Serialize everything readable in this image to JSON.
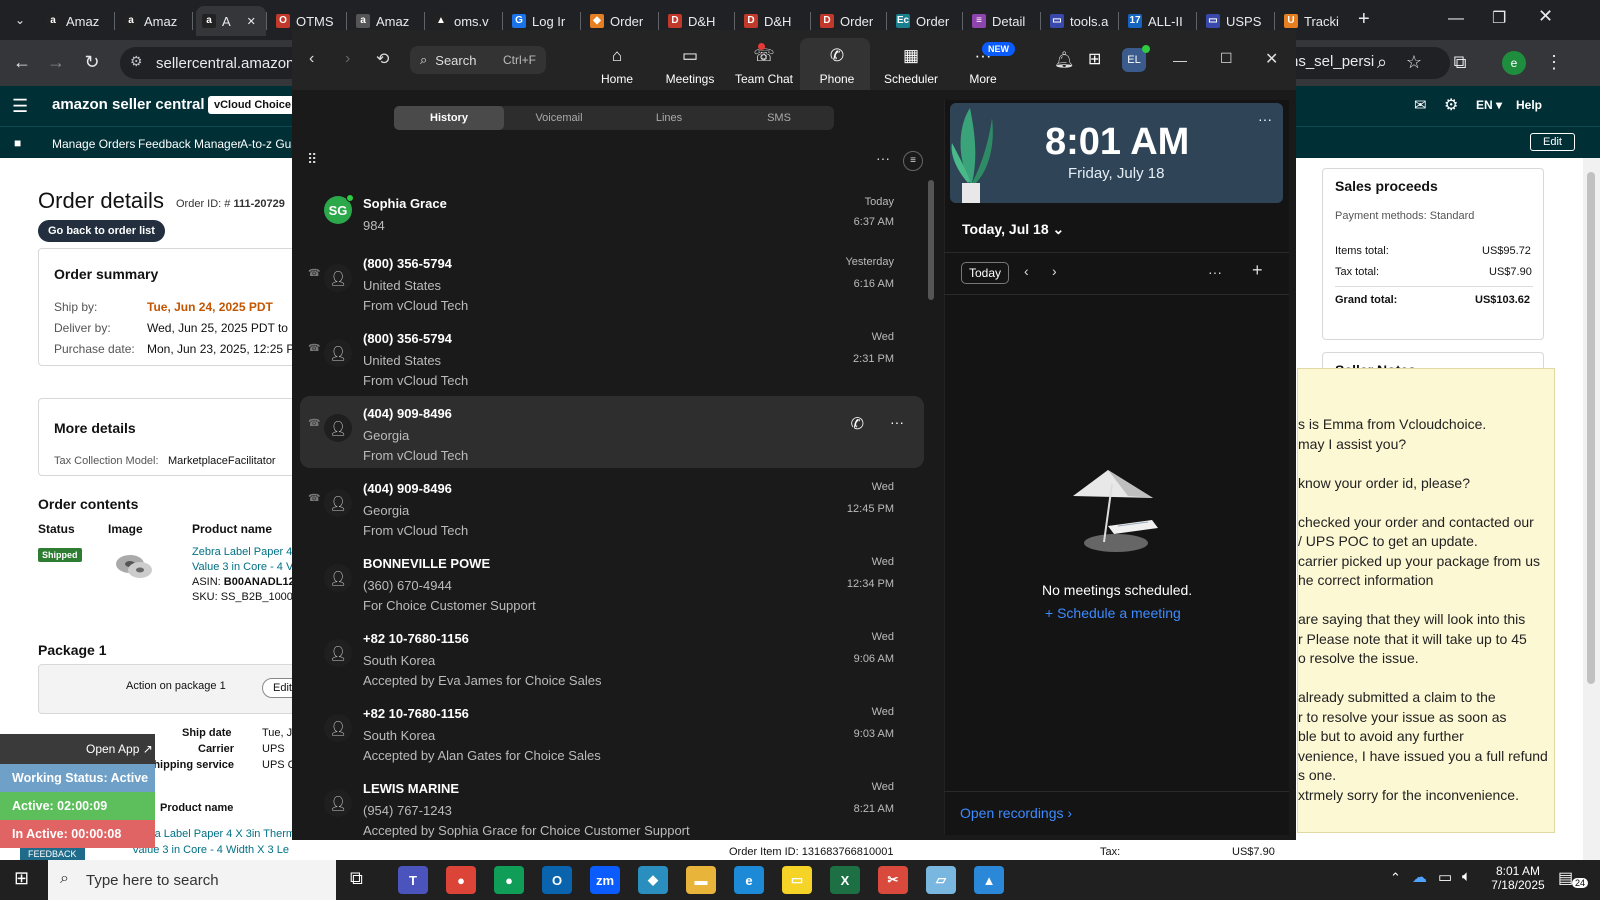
{
  "browser": {
    "tabs": [
      "Amaz",
      "Amaz",
      "A",
      "OTMS",
      "Amaz",
      "oms.v",
      "Log Ir",
      "Order",
      "D&H",
      "D&H",
      "Order",
      "Order",
      "Detail",
      "tools.a",
      "ALL-II",
      "USPS",
      "Tracki"
    ],
    "url": "sellercentral.amazon.c",
    "url_tail": "ns_sel_persi",
    "profile_initial": "e"
  },
  "seller": {
    "logo": "amazon seller central",
    "store": "vCloud Choice",
    "lang": "EN",
    "help": "Help",
    "nav": [
      "Manage Orders",
      "Feedback Manager",
      "A-to-z Gua"
    ],
    "edit": "Edit",
    "title": "Order details",
    "order_id_label": "Order ID: #",
    "order_id": "111-20729",
    "back_button": "Go back to order list",
    "summary": {
      "title": "Order summary",
      "ship_by_label": "Ship by:",
      "ship_by": "Tue, Jun 24, 2025 PDT",
      "deliver_by_label": "Deliver by:",
      "deliver_by": "Wed, Jun 25, 2025 PDT to M",
      "purchase_label": "Purchase date:",
      "purchase": "Mon, Jun 23, 2025, 12:25 P"
    },
    "more": {
      "title": "More details",
      "tax_label": "Tax Collection Model:",
      "tax": "MarketplaceFacilitator"
    },
    "contents": {
      "title": "Order contents",
      "cols": [
        "Status",
        "Image",
        "Product name"
      ],
      "status": "Shipped",
      "product": "Zebra Label Paper 4",
      "product2": "Value 3 in Core - 4 V",
      "asin_label": "ASIN:",
      "asin": "B00ANADL12",
      "sku_label": "SKU:",
      "sku": "SS_B2B_1000("
    },
    "package": {
      "title": "Package 1",
      "action": "Action on package 1",
      "edit": "Edit",
      "ship_date_label": "Ship date",
      "ship_date": "Tue, J",
      "carrier_label": "Carrier",
      "carrier": "UPS",
      "service_label": "Shipping service",
      "service": "UPS G"
    },
    "product_name_hdr": "Product name",
    "product_line1": "Zebra Label Paper 4 X 3in Therm",
    "product_line2": "Value 3 in Core - 4 Width X 3 Le",
    "footer": {
      "item_id": "Order Item ID: 131683766810001",
      "tax_label": "Tax:",
      "tax": "US$7.90"
    },
    "proceeds": {
      "title": "Sales proceeds",
      "methods": "Payment methods: Standard",
      "items_label": "Items total:",
      "items": "US$95.72",
      "tax_label": "Tax total:",
      "tax": "US$7.90",
      "grand_label": "Grand total:",
      "grand": "US$103.62"
    },
    "seller_notes": "Seller Notes"
  },
  "notes": [
    "s is Emma from Vcloudchoice.",
    "may I assist you?",
    "",
    "know your order id, please?",
    "",
    "checked your order and contacted our",
    "/ UPS   POC   to get an update.",
    "carrier picked up your package from us",
    "he correct information",
    "",
    "are saying that they will look into this",
    "r Please note that it will take up to 45",
    "o resolve the issue.",
    "",
    "already submitted a claim to the",
    "r to resolve your issue as soon as",
    "ble but to avoid any further",
    "venience, I have issued you a full refund",
    "s one.",
    "xtrmely sorry for the inconvenience."
  ],
  "zoom": {
    "search": "Search",
    "shortcut": "Ctrl+F",
    "nav": [
      {
        "label": "Home",
        "icon": "⌂"
      },
      {
        "label": "Meetings",
        "icon": "▭"
      },
      {
        "label": "Team Chat",
        "icon": "☏"
      },
      {
        "label": "Phone",
        "icon": "✆"
      },
      {
        "label": "Scheduler",
        "icon": "▦"
      },
      {
        "label": "More",
        "icon": "···"
      }
    ],
    "new_badge": "NEW",
    "avatar": "EL",
    "tabs": [
      "History",
      "Voicemail",
      "Lines",
      "SMS"
    ],
    "calls": [
      {
        "name": "Sophia Grace",
        "line2": "984",
        "line3": "",
        "date": "Today",
        "time": "6:37 AM",
        "initials": "SG"
      },
      {
        "name": "(800) 356-5794",
        "line2": "United States",
        "line3": "From vCloud Tech",
        "date": "Yesterday",
        "time": "6:16 AM"
      },
      {
        "name": "(800) 356-5794",
        "line2": "United States",
        "line3": "From vCloud Tech",
        "date": "Wed",
        "time": "2:31 PM"
      },
      {
        "name": "(404) 909-8496",
        "line2": "Georgia",
        "line3": "From vCloud Tech",
        "date": "",
        "time": ""
      },
      {
        "name": "(404) 909-8496",
        "line2": "Georgia",
        "line3": "From vCloud Tech",
        "date": "Wed",
        "time": "12:45 PM"
      },
      {
        "name": "BONNEVILLE POWE",
        "line2": "(360) 670-4944",
        "line3": "For Choice Customer Support",
        "date": "Wed",
        "time": "12:34 PM"
      },
      {
        "name": "+82 10-7680-1156",
        "line2": "South Korea",
        "line3": "Accepted by Eva James for Choice Sales",
        "date": "Wed",
        "time": "9:06 AM"
      },
      {
        "name": "+82 10-7680-1156",
        "line2": "South Korea",
        "line3": "Accepted by Alan Gates for Choice Sales",
        "date": "Wed",
        "time": "9:03 AM"
      },
      {
        "name": "LEWIS MARINE",
        "line2": "(954) 767-1243",
        "line3": "Accepted by Sophia Grace for Choice Customer Support",
        "date": "Wed",
        "time": "8:21 AM"
      }
    ],
    "clock": {
      "time": "8:01 AM",
      "date": "Friday, July 18"
    },
    "day_label": "Today, Jul 18",
    "today_btn": "Today",
    "empty": "No meetings scheduled.",
    "schedule": "Schedule a meeting",
    "recordings": "Open recordings"
  },
  "widget": {
    "open_app": "Open App",
    "status": "Working Status: Active",
    "active": "Active: 02:00:09",
    "inactive": "In Active: 00:00:08",
    "feedback": "FEEDBACK"
  },
  "taskbar": {
    "search": "Type here to search",
    "time": "8:01 AM",
    "date": "7/18/2025",
    "notif": "24"
  }
}
